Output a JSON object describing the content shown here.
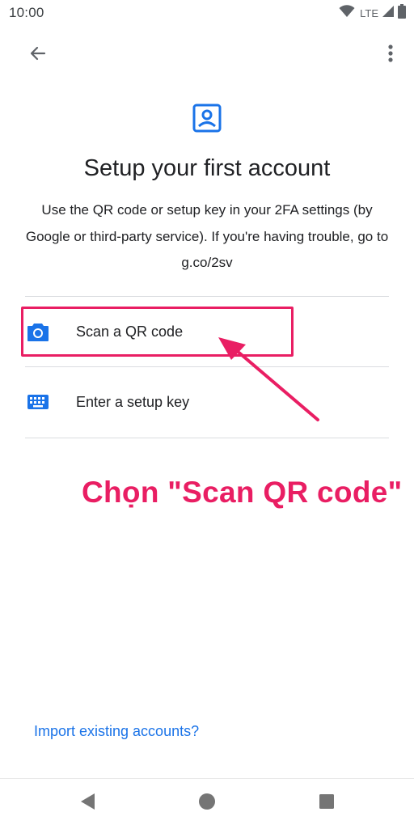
{
  "status_bar": {
    "time": "10:00",
    "network": "LTE",
    "icons": [
      "wifi-icon",
      "lte-signal-icon",
      "battery-icon"
    ]
  },
  "app_bar": {
    "back_icon": "arrow-back-icon",
    "menu_icon": "more-vert-icon"
  },
  "header": {
    "icon": "account-box-icon",
    "title": "Setup your first account",
    "description": "Use the QR code or setup key in your 2FA settings (by Google or third-party service). If you're having trouble, go to g.co/2sv"
  },
  "options": [
    {
      "label": "Scan a QR code",
      "icon": "camera-icon"
    },
    {
      "label": "Enter a setup key",
      "icon": "keyboard-icon"
    }
  ],
  "annotation": {
    "text": "Chọn \"Scan QR code\"",
    "color": "#e91e63"
  },
  "footer": {
    "import_link": "Import existing accounts?"
  },
  "nav_bar": {
    "back": "nav-back-icon",
    "home": "nav-home-icon",
    "recents": "nav-recents-icon"
  },
  "colors": {
    "accent": "#1a73e8",
    "highlight": "#e91e63",
    "text": "#202124"
  }
}
